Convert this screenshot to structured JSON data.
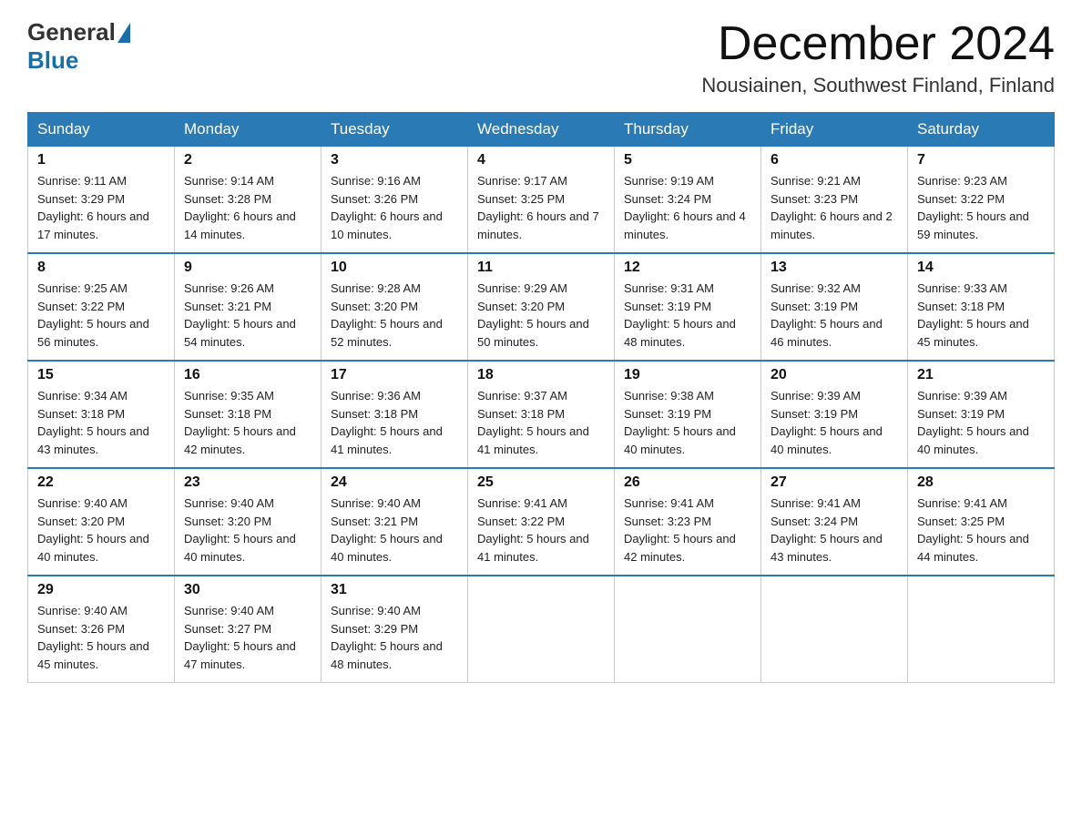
{
  "logo": {
    "general": "General",
    "blue": "Blue"
  },
  "title": "December 2024",
  "location": "Nousiainen, Southwest Finland, Finland",
  "days_of_week": [
    "Sunday",
    "Monday",
    "Tuesday",
    "Wednesday",
    "Thursday",
    "Friday",
    "Saturday"
  ],
  "weeks": [
    [
      {
        "num": "1",
        "sunrise": "9:11 AM",
        "sunset": "3:29 PM",
        "daylight": "6 hours and 17 minutes."
      },
      {
        "num": "2",
        "sunrise": "9:14 AM",
        "sunset": "3:28 PM",
        "daylight": "6 hours and 14 minutes."
      },
      {
        "num": "3",
        "sunrise": "9:16 AM",
        "sunset": "3:26 PM",
        "daylight": "6 hours and 10 minutes."
      },
      {
        "num": "4",
        "sunrise": "9:17 AM",
        "sunset": "3:25 PM",
        "daylight": "6 hours and 7 minutes."
      },
      {
        "num": "5",
        "sunrise": "9:19 AM",
        "sunset": "3:24 PM",
        "daylight": "6 hours and 4 minutes."
      },
      {
        "num": "6",
        "sunrise": "9:21 AM",
        "sunset": "3:23 PM",
        "daylight": "6 hours and 2 minutes."
      },
      {
        "num": "7",
        "sunrise": "9:23 AM",
        "sunset": "3:22 PM",
        "daylight": "5 hours and 59 minutes."
      }
    ],
    [
      {
        "num": "8",
        "sunrise": "9:25 AM",
        "sunset": "3:22 PM",
        "daylight": "5 hours and 56 minutes."
      },
      {
        "num": "9",
        "sunrise": "9:26 AM",
        "sunset": "3:21 PM",
        "daylight": "5 hours and 54 minutes."
      },
      {
        "num": "10",
        "sunrise": "9:28 AM",
        "sunset": "3:20 PM",
        "daylight": "5 hours and 52 minutes."
      },
      {
        "num": "11",
        "sunrise": "9:29 AM",
        "sunset": "3:20 PM",
        "daylight": "5 hours and 50 minutes."
      },
      {
        "num": "12",
        "sunrise": "9:31 AM",
        "sunset": "3:19 PM",
        "daylight": "5 hours and 48 minutes."
      },
      {
        "num": "13",
        "sunrise": "9:32 AM",
        "sunset": "3:19 PM",
        "daylight": "5 hours and 46 minutes."
      },
      {
        "num": "14",
        "sunrise": "9:33 AM",
        "sunset": "3:18 PM",
        "daylight": "5 hours and 45 minutes."
      }
    ],
    [
      {
        "num": "15",
        "sunrise": "9:34 AM",
        "sunset": "3:18 PM",
        "daylight": "5 hours and 43 minutes."
      },
      {
        "num": "16",
        "sunrise": "9:35 AM",
        "sunset": "3:18 PM",
        "daylight": "5 hours and 42 minutes."
      },
      {
        "num": "17",
        "sunrise": "9:36 AM",
        "sunset": "3:18 PM",
        "daylight": "5 hours and 41 minutes."
      },
      {
        "num": "18",
        "sunrise": "9:37 AM",
        "sunset": "3:18 PM",
        "daylight": "5 hours and 41 minutes."
      },
      {
        "num": "19",
        "sunrise": "9:38 AM",
        "sunset": "3:19 PM",
        "daylight": "5 hours and 40 minutes."
      },
      {
        "num": "20",
        "sunrise": "9:39 AM",
        "sunset": "3:19 PM",
        "daylight": "5 hours and 40 minutes."
      },
      {
        "num": "21",
        "sunrise": "9:39 AM",
        "sunset": "3:19 PM",
        "daylight": "5 hours and 40 minutes."
      }
    ],
    [
      {
        "num": "22",
        "sunrise": "9:40 AM",
        "sunset": "3:20 PM",
        "daylight": "5 hours and 40 minutes."
      },
      {
        "num": "23",
        "sunrise": "9:40 AM",
        "sunset": "3:20 PM",
        "daylight": "5 hours and 40 minutes."
      },
      {
        "num": "24",
        "sunrise": "9:40 AM",
        "sunset": "3:21 PM",
        "daylight": "5 hours and 40 minutes."
      },
      {
        "num": "25",
        "sunrise": "9:41 AM",
        "sunset": "3:22 PM",
        "daylight": "5 hours and 41 minutes."
      },
      {
        "num": "26",
        "sunrise": "9:41 AM",
        "sunset": "3:23 PM",
        "daylight": "5 hours and 42 minutes."
      },
      {
        "num": "27",
        "sunrise": "9:41 AM",
        "sunset": "3:24 PM",
        "daylight": "5 hours and 43 minutes."
      },
      {
        "num": "28",
        "sunrise": "9:41 AM",
        "sunset": "3:25 PM",
        "daylight": "5 hours and 44 minutes."
      }
    ],
    [
      {
        "num": "29",
        "sunrise": "9:40 AM",
        "sunset": "3:26 PM",
        "daylight": "5 hours and 45 minutes."
      },
      {
        "num": "30",
        "sunrise": "9:40 AM",
        "sunset": "3:27 PM",
        "daylight": "5 hours and 47 minutes."
      },
      {
        "num": "31",
        "sunrise": "9:40 AM",
        "sunset": "3:29 PM",
        "daylight": "5 hours and 48 minutes."
      },
      null,
      null,
      null,
      null
    ]
  ]
}
